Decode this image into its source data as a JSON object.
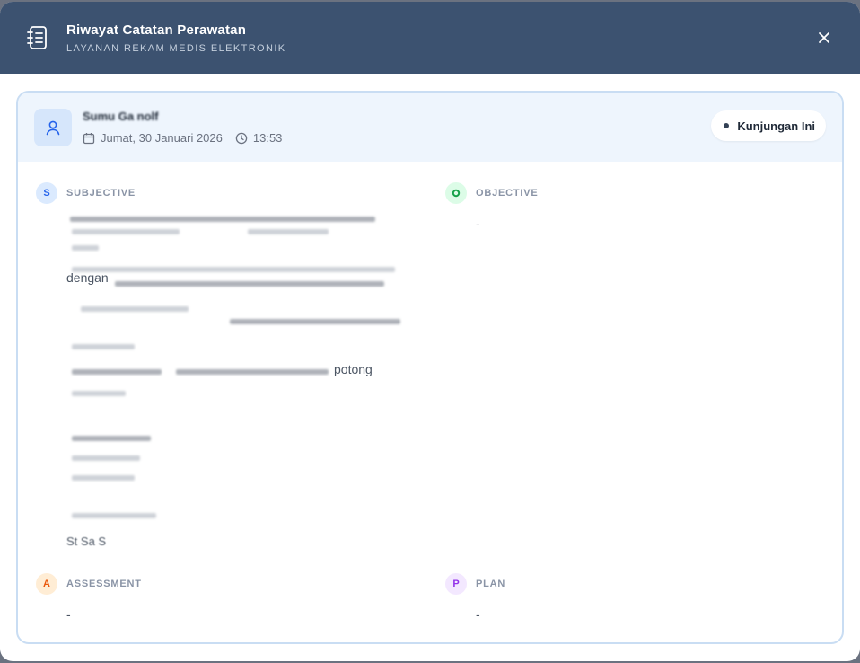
{
  "header": {
    "title": "Riwayat Catatan Perawatan",
    "subtitle": "LAYANAN REKAM MEDIS ELEKTRONIK",
    "icon": "notebook-icon",
    "close_icon": "close-icon"
  },
  "record": {
    "patient_name": "Sumu  Ga  nolf",
    "date": "Jumat, 30 Januari 2026",
    "time": "13:53",
    "badge": "Kunjungan Ini"
  },
  "sections": {
    "subjective": {
      "letter": "S",
      "label": "SUBJECTIVE",
      "fragments": [
        "dengan",
        "potong",
        "St  Sa  S"
      ]
    },
    "objective": {
      "letter": "O",
      "label": "OBJECTIVE",
      "value": "-"
    },
    "assessment": {
      "letter": "A",
      "label": "ASSESSMENT",
      "value": "-"
    },
    "plan": {
      "letter": "P",
      "label": "PLAN",
      "value": "-"
    }
  },
  "colors": {
    "header_bg": "#3c5270",
    "card_border": "#c9ddf3",
    "subjective": "#2563eb",
    "objective": "#16a34a",
    "assessment": "#ea580c",
    "plan": "#9333ea"
  }
}
